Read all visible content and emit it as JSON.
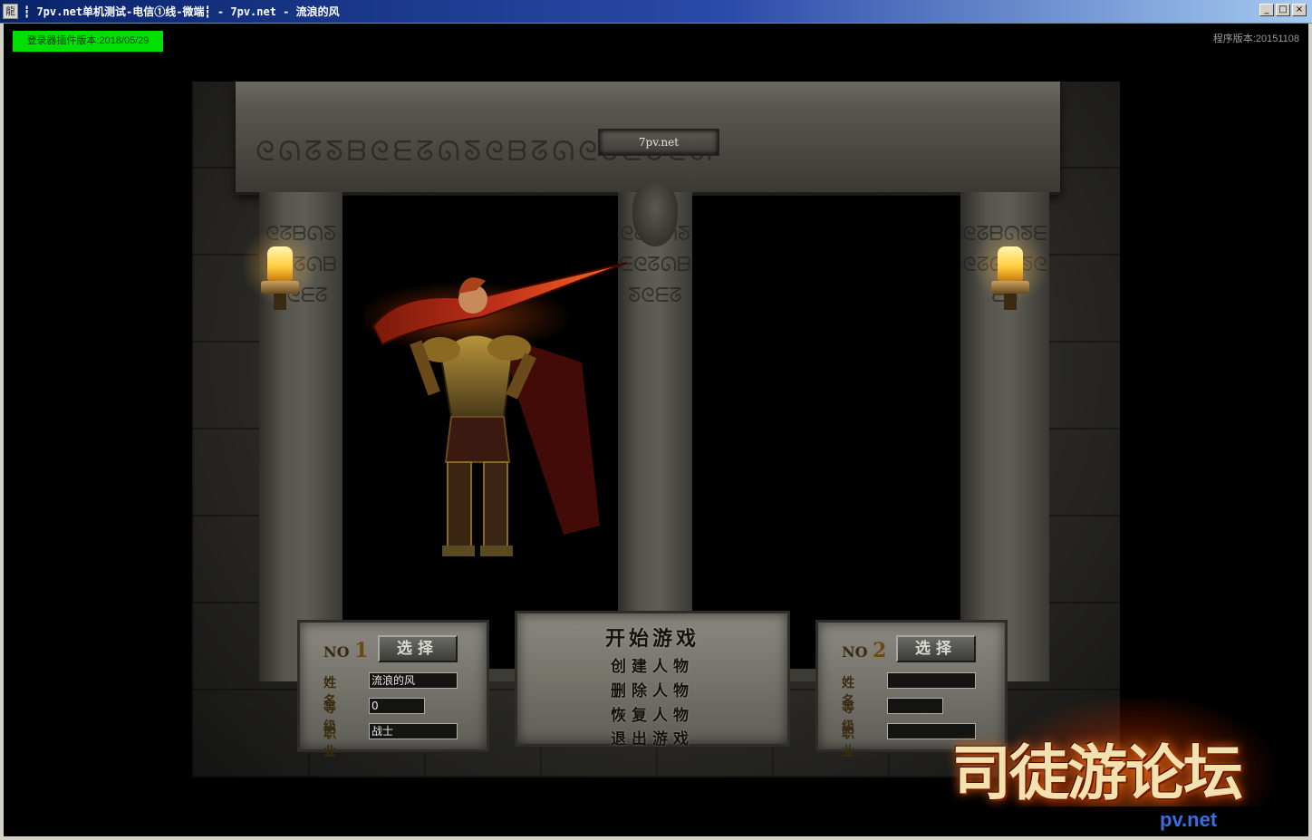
{
  "window": {
    "app_icon_glyph": "龍",
    "title": "7pv.net单机测试-电信①线-微端┇ - 7pv.net - 流浪的风",
    "title_prefix": "┇ ",
    "controls": [
      "_",
      "□",
      "×"
    ]
  },
  "overlay": {
    "plugin_version": "登录器插件版本:2018/05/29",
    "program_version": "程序版本:20151108"
  },
  "hall": {
    "plaque_text": "7pv.net",
    "lintel_runes": "ᘓᘏᘔᘕᗷᘓᗴᘔᘏᘕᘓᗷᘔᘏᘓᘕᗴᘔᘓᘏ",
    "pillar_runes": "ᘓᘔᗷᘏᘕᗴᘓᘔᘏᗷᘕᘓᗴᘔ"
  },
  "slots": [
    {
      "no_label": "NO",
      "number": "1",
      "select_label": "选择",
      "name_label": "姓名",
      "level_label": "等级",
      "job_label": "职业",
      "name": "流浪的风",
      "level": "0",
      "job": "战士"
    },
    {
      "no_label": "NO",
      "number": "2",
      "select_label": "选择",
      "name_label": "姓名",
      "level_label": "等级",
      "job_label": "职业",
      "name": "",
      "level": "",
      "job": ""
    }
  ],
  "menu": {
    "start": "开始游戏",
    "create": "创建人物",
    "delete": "删除人物",
    "restore": "恢复人物",
    "exit": "退出游戏"
  },
  "watermark": {
    "text": "司徒游论坛",
    "url": "pv.net"
  },
  "colors": {
    "plugin_badge_bg": "#00e000",
    "titlebar_start": "#0a246a",
    "titlebar_end": "#a6caf0"
  }
}
